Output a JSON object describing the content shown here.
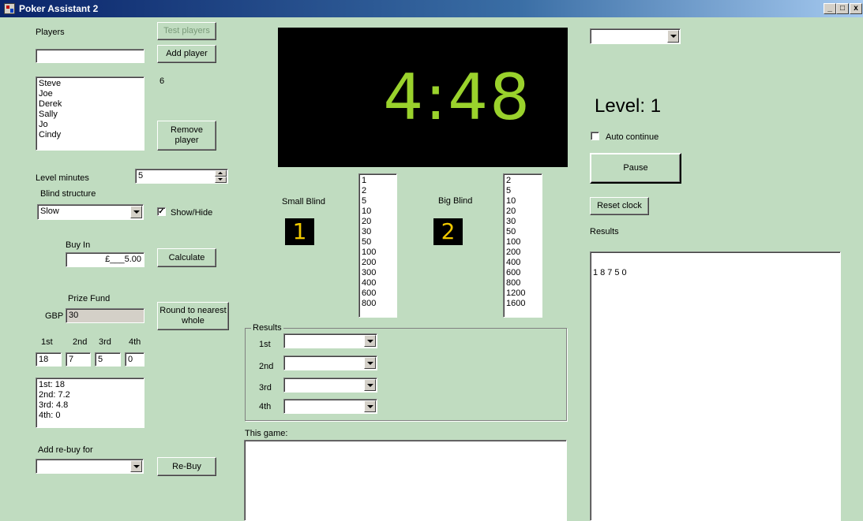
{
  "window": {
    "title": "Poker Assistant 2",
    "minimize": "_",
    "maximize": "□",
    "close": "x"
  },
  "players": {
    "label": "Players",
    "input_value": "",
    "test_button": "Test players",
    "add_button": "Add player",
    "list": [
      "Steve",
      "Joe",
      "Derek",
      "Sally",
      "Jo",
      "Cindy"
    ],
    "count": "6",
    "remove_button": "Remove player"
  },
  "level": {
    "minutes_label": "Level minutes",
    "minutes_value": "5"
  },
  "blind_structure": {
    "label": "Blind structure",
    "value": "Slow",
    "show_hide_label": "Show/Hide",
    "show_hide_checked": "✓"
  },
  "buy_in": {
    "label": "Buy In",
    "value": "£___5.00",
    "calculate_button": "Calculate"
  },
  "prize_fund": {
    "label": "Prize Fund",
    "currency": "GBP",
    "value": "30",
    "round_button": "Round to nearest whole"
  },
  "places": {
    "headers": [
      "1st",
      "2nd",
      "3rd",
      "4th"
    ],
    "values": [
      "18",
      "7",
      "5",
      "0"
    ],
    "summary": [
      "1st: 18",
      "2nd: 7.2",
      "3rd: 4.8",
      "4th: 0"
    ]
  },
  "rebuy": {
    "label": "Add re-buy for",
    "value": "",
    "button": "Re-Buy"
  },
  "clock": {
    "time": "4:48"
  },
  "blinds": {
    "small_label": "Small Blind",
    "small_value": "1",
    "small_list": [
      "1",
      "2",
      "5",
      "10",
      "20",
      "30",
      "50",
      "100",
      "200",
      "300",
      "400",
      "600",
      "800"
    ],
    "big_label": "Big Blind",
    "big_value": "2",
    "big_list": [
      "2",
      "5",
      "10",
      "20",
      "30",
      "50",
      "100",
      "200",
      "400",
      "600",
      "800",
      "1200",
      "1600"
    ]
  },
  "results_group": {
    "label": "Results",
    "rows": [
      {
        "label": "1st",
        "value": ""
      },
      {
        "label": "2nd",
        "value": ""
      },
      {
        "label": "3rd",
        "value": ""
      },
      {
        "label": "4th",
        "value": ""
      }
    ]
  },
  "this_game": {
    "label": "This game:",
    "text": ""
  },
  "right": {
    "top_combo_value": "",
    "level_text": "Level: 1",
    "auto_continue_label": "Auto continue",
    "pause_button": "Pause",
    "reset_button": "Reset clock",
    "results_label": "Results",
    "results_text": "18750"
  }
}
